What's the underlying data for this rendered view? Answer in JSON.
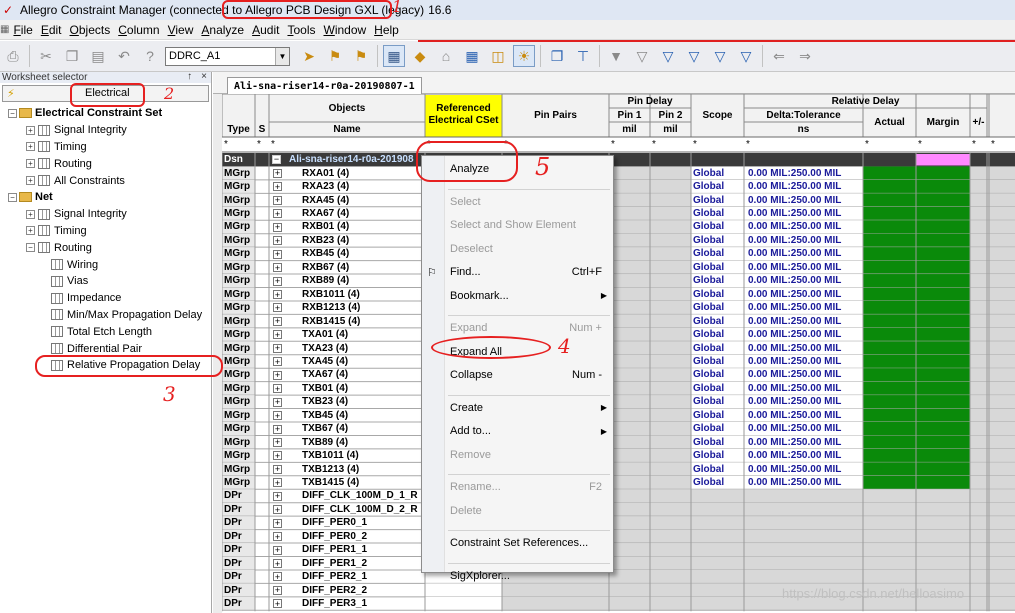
{
  "title": {
    "prefix": "Allegro Constraint Manager (connected to",
    "app": "Allegro PCB Design GXL (legacy)",
    "suffix": "16.6"
  },
  "menu": [
    "File",
    "Edit",
    "Objects",
    "Column",
    "View",
    "Analyze",
    "Audit",
    "Tools",
    "Window",
    "Help"
  ],
  "toolbar": {
    "combo_value": "DDRC_A1"
  },
  "panel": {
    "title": "Worksheet selector",
    "pin": "↑",
    "close": "×",
    "selected": "Electrical"
  },
  "tree": {
    "ecs": "Electrical Constraint Set",
    "ecs_items": [
      "Signal Integrity",
      "Timing",
      "Routing",
      "All Constraints"
    ],
    "net": "Net",
    "net_items": [
      "Signal Integrity",
      "Timing",
      "Routing"
    ],
    "routing_items": [
      "Wiring",
      "Vias",
      "Impedance",
      "Min/Max Propagation Delay",
      "Total Etch Length",
      "Differential Pair",
      "Relative Propagation Delay"
    ]
  },
  "tab": "Ali-sna-riser14-r0a-20190807-1",
  "headers": {
    "objects": "Objects",
    "type": "Type",
    "s": "S",
    "name": "Name",
    "ref_cset": "Referenced Electrical CSet",
    "pin_pairs": "Pin Pairs",
    "pin_delay": "Pin Delay",
    "pin1": "Pin 1",
    "pin2": "Pin 2",
    "mil": "mil",
    "scope": "Scope",
    "relative_delay": "Relative Delay",
    "delta_tol": "Delta:Tolerance",
    "ns": "ns",
    "actual": "Actual",
    "margin": "Margin",
    "plusminus": "+/-",
    "len": "Len",
    "star": "*"
  },
  "design_row": {
    "type": "Dsn",
    "name": "Ali-sna-riser14-r0a-201908"
  },
  "rows": [
    {
      "type": "MGrp",
      "name": "RXA01 (4)"
    },
    {
      "type": "MGrp",
      "name": "RXA23 (4)"
    },
    {
      "type": "MGrp",
      "name": "RXA45 (4)"
    },
    {
      "type": "MGrp",
      "name": "RXA67 (4)"
    },
    {
      "type": "MGrp",
      "name": "RXB01 (4)"
    },
    {
      "type": "MGrp",
      "name": "RXB23 (4)"
    },
    {
      "type": "MGrp",
      "name": "RXB45 (4)"
    },
    {
      "type": "MGrp",
      "name": "RXB67 (4)"
    },
    {
      "type": "MGrp",
      "name": "RXB89 (4)"
    },
    {
      "type": "MGrp",
      "name": "RXB1011 (4)"
    },
    {
      "type": "MGrp",
      "name": "RXB1213 (4)"
    },
    {
      "type": "MGrp",
      "name": "RXB1415 (4)"
    },
    {
      "type": "MGrp",
      "name": "TXA01 (4)"
    },
    {
      "type": "MGrp",
      "name": "TXA23 (4)"
    },
    {
      "type": "MGrp",
      "name": "TXA45 (4)"
    },
    {
      "type": "MGrp",
      "name": "TXA67 (4)"
    },
    {
      "type": "MGrp",
      "name": "TXB01 (4)"
    },
    {
      "type": "MGrp",
      "name": "TXB23 (4)"
    },
    {
      "type": "MGrp",
      "name": "TXB45 (4)"
    },
    {
      "type": "MGrp",
      "name": "TXB67 (4)"
    },
    {
      "type": "MGrp",
      "name": "TXB89 (4)"
    },
    {
      "type": "MGrp",
      "name": "TXB1011 (4)"
    },
    {
      "type": "MGrp",
      "name": "TXB1213 (4)"
    },
    {
      "type": "MGrp",
      "name": "TXB1415 (4)"
    },
    {
      "type": "DPr",
      "name": "DIFF_CLK_100M_D_1_R"
    },
    {
      "type": "DPr",
      "name": "DIFF_CLK_100M_D_2_R"
    },
    {
      "type": "DPr",
      "name": "DIFF_PER0_1"
    },
    {
      "type": "DPr",
      "name": "DIFF_PER0_2"
    },
    {
      "type": "DPr",
      "name": "DIFF_PER1_1"
    },
    {
      "type": "DPr",
      "name": "DIFF_PER1_2"
    },
    {
      "type": "DPr",
      "name": "DIFF_PER2_1"
    },
    {
      "type": "DPr",
      "name": "DIFF_PER2_2"
    },
    {
      "type": "DPr",
      "name": "DIFF_PER3_1"
    }
  ],
  "mgrp_values": {
    "scope": "Global",
    "delta": "0.00 MIL:250.00 MIL"
  },
  "colors": {
    "pass": "#0a8a0a",
    "margin_header": "#ff88ff",
    "ref_cset_header": "#ffff00",
    "value_text": "#1a1a9a",
    "annotation": "#e62020"
  },
  "context_menu": [
    {
      "label": "Analyze",
      "enabled": true
    },
    {
      "sep": true
    },
    {
      "label": "Select",
      "enabled": false
    },
    {
      "label": "Select and Show Element",
      "enabled": false
    },
    {
      "label": "Deselect",
      "enabled": false
    },
    {
      "label": "Find...",
      "enabled": true,
      "shortcut": "Ctrl+F"
    },
    {
      "label": "Bookmark...",
      "enabled": true,
      "submenu": true
    },
    {
      "sep": true
    },
    {
      "label": "Expand",
      "enabled": false,
      "shortcut": "Num +"
    },
    {
      "label": "Expand All",
      "enabled": true
    },
    {
      "label": "Collapse",
      "enabled": true,
      "shortcut": "Num -"
    },
    {
      "sep": true
    },
    {
      "label": "Create",
      "enabled": true,
      "submenu": true
    },
    {
      "label": "Add to...",
      "enabled": true,
      "submenu": true
    },
    {
      "label": "Remove",
      "enabled": false
    },
    {
      "sep": true
    },
    {
      "label": "Rename...",
      "enabled": false,
      "shortcut": "F2"
    },
    {
      "label": "Delete",
      "enabled": false
    },
    {
      "sep": true
    },
    {
      "label": "Constraint Set References...",
      "enabled": true
    },
    {
      "sep": true
    },
    {
      "label": "SigXplorer...",
      "enabled": true
    }
  ],
  "annotations": [
    "1",
    "2",
    "3",
    "4",
    "5"
  ],
  "watermark": "https://blog.csdn.net/helloasimo"
}
